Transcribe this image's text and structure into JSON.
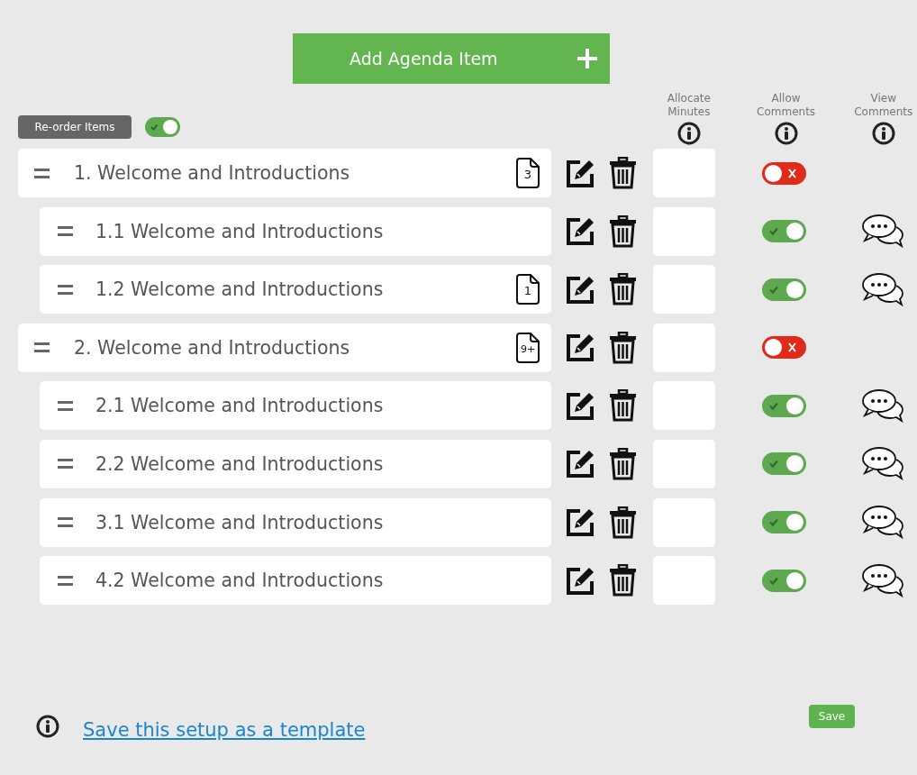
{
  "add_button": {
    "label": "Add Agenda Item"
  },
  "reorder": {
    "label": "Re-order Items",
    "on": true
  },
  "columns": [
    {
      "label": "Allocate Minutes"
    },
    {
      "label": "Allow Comments"
    },
    {
      "label": "View Comments"
    }
  ],
  "items": [
    {
      "title": "1. Welcome and Introductions",
      "badge": "3",
      "allow_comments": false,
      "children": [
        {
          "title": "1.1 Welcome and Introductions",
          "allow_comments": true
        },
        {
          "title": "1.2 Welcome and Introductions",
          "badge": "1",
          "allow_comments": true
        }
      ]
    },
    {
      "title": "2. Welcome and Introductions",
      "badge": "9+",
      "allow_comments": false,
      "children": [
        {
          "title": "2.1 Welcome and Introductions",
          "allow_comments": true
        },
        {
          "title": "2.2 Welcome and Introductions",
          "allow_comments": true
        },
        {
          "title": "3.1 Welcome and Introductions",
          "allow_comments": true
        },
        {
          "title": "4.2 Welcome and Introductions",
          "allow_comments": true
        }
      ]
    }
  ],
  "footer": {
    "link": "Save this setup as a template",
    "save_button": "Save"
  }
}
